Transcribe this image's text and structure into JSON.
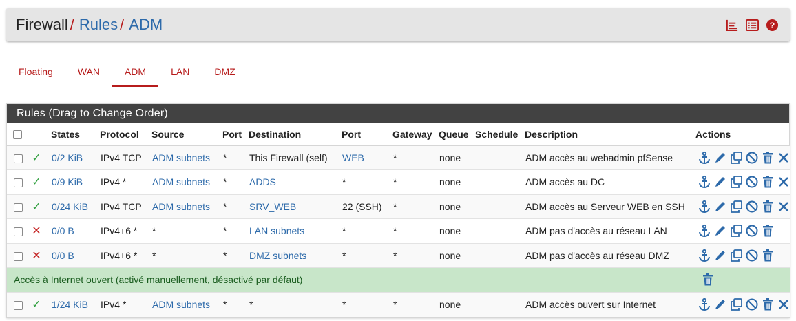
{
  "breadcrumb": {
    "root": "Firewall",
    "separator": "/",
    "rules": "Rules",
    "current": "ADM"
  },
  "header_icons": [
    "chart-icon",
    "list-icon",
    "help-icon"
  ],
  "tabs": [
    {
      "label": "Floating",
      "active": false
    },
    {
      "label": "WAN",
      "active": false
    },
    {
      "label": "ADM",
      "active": true
    },
    {
      "label": "LAN",
      "active": false
    },
    {
      "label": "DMZ",
      "active": false
    }
  ],
  "panel_title": "Rules (Drag to Change Order)",
  "columns": {
    "states": "States",
    "protocol": "Protocol",
    "source": "Source",
    "port": "Port",
    "destination": "Destination",
    "dport": "Port",
    "gateway": "Gateway",
    "queue": "Queue",
    "schedule": "Schedule",
    "description": "Description",
    "actions": "Actions"
  },
  "rules": [
    {
      "status": "pass",
      "states": "0/2 KiB",
      "protocol": "IPv4 TCP",
      "source": "ADM subnets",
      "port": "*",
      "destination": "This Firewall (self)",
      "dport": "WEB",
      "gateway": "*",
      "queue": "none",
      "schedule": "",
      "description": "ADM accès au webadmin pfSense",
      "delete_icon": true
    },
    {
      "status": "pass",
      "states": "0/9 KiB",
      "protocol": "IPv4 *",
      "source": "ADM subnets",
      "port": "*",
      "destination": "ADDS",
      "dport": "*",
      "gateway": "*",
      "queue": "none",
      "schedule": "",
      "description": "ADM accès au DC",
      "delete_icon": true
    },
    {
      "status": "pass",
      "states": "0/24 KiB",
      "protocol": "IPv4 TCP",
      "source": "ADM subnets",
      "port": "*",
      "destination": "SRV_WEB",
      "dport": "22 (SSH)",
      "gateway": "*",
      "queue": "none",
      "schedule": "",
      "description": "ADM accès au Serveur WEB en SSH",
      "delete_icon": true
    },
    {
      "status": "block",
      "states": "0/0 B",
      "protocol": "IPv4+6 *",
      "source": "*",
      "port": "*",
      "destination": "LAN subnets",
      "dport": "*",
      "gateway": "*",
      "queue": "none",
      "schedule": "",
      "description": "ADM pas d'accès au réseau LAN",
      "delete_icon": false
    },
    {
      "status": "block",
      "states": "0/0 B",
      "protocol": "IPv4+6 *",
      "source": "*",
      "port": "*",
      "destination": "DMZ subnets",
      "dport": "*",
      "gateway": "*",
      "queue": "none",
      "schedule": "",
      "description": "ADM pas d'accès au réseau DMZ",
      "delete_icon": false
    }
  ],
  "separator_row": "Accès à Internet ouvert (activé manuellement, désactivé par défaut)",
  "last_rule": {
    "status": "pass",
    "states": "1/24 KiB",
    "protocol": "IPv4 *",
    "source": "ADM subnets",
    "port": "*",
    "destination": "*",
    "dport": "*",
    "gateway": "*",
    "queue": "none",
    "schedule": "",
    "description": "ADM accès ouvert sur Internet",
    "delete_icon": true
  },
  "colors": {
    "accent": "#b71c1c",
    "link": "#2d6aaa",
    "pass": "#2e9e3d",
    "block": "#c62828",
    "separator_bg": "#c8e6c9",
    "panel_head": "#424242"
  }
}
